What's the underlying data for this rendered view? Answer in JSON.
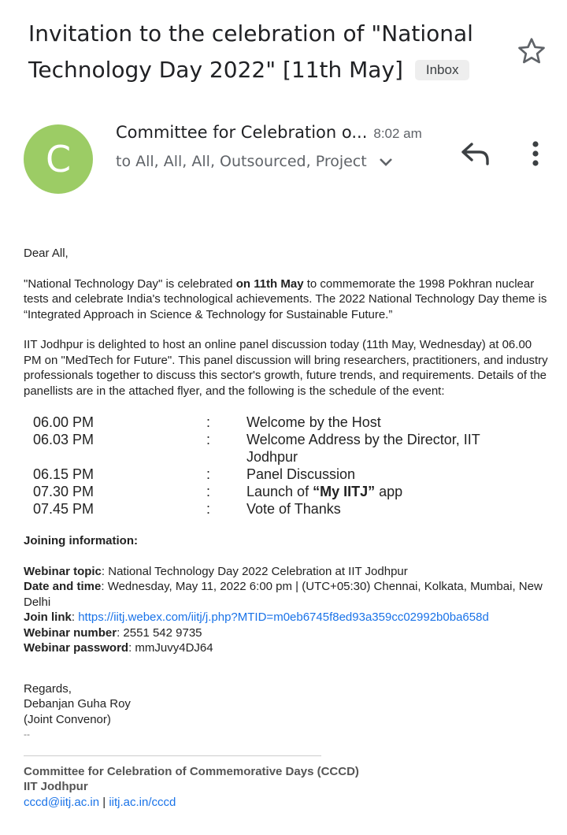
{
  "subject": {
    "title": "Invitation to the celebration of \"National Technology Day 2022\" [11th May]",
    "label": "Inbox"
  },
  "header": {
    "avatar_letter": "C",
    "avatar_color": "#9ccc65",
    "sender": "Committee for Celebration o...",
    "time": "8:02 am",
    "recipients": "to All, All, All, Outsourced, Project"
  },
  "icons": [
    "star-icon",
    "reply-icon",
    "more-vert-icon",
    "chevron-down-icon"
  ],
  "body": {
    "greeting": "Dear All,",
    "p1_a": "\"National Technology Day\" is celebrated ",
    "p1_bold": "on 11th May",
    "p1_b": " to commemorate the 1998 Pokhran nuclear tests and celebrate India's technological achievements. The 2022 National Technology Day theme is “Integrated Approach in Science & Technology for Sustainable Future.”",
    "p2": "IIT Jodhpur is delighted to host an online panel discussion today (11th May, Wednesday) at 06.00 PM on \"MedTech for Future\". This panel discussion will bring researchers, practitioners, and industry professionals together to discuss this sector's growth, future trends, and requirements. Details of the panellists are in the attached flyer, and the following is the schedule of the event:",
    "schedule": [
      {
        "time": "06.00 PM",
        "sep": ":",
        "desc": "Welcome by the Host"
      },
      {
        "time": "06.03 PM",
        "sep": ":",
        "desc": "Welcome Address by the Director, IIT Jodhpur"
      },
      {
        "time": "06.15 PM",
        "sep": ":",
        "desc": "Panel Discussion"
      },
      {
        "time": "07.30 PM",
        "sep": ":",
        "desc_a": "Launch of ",
        "desc_bold": "“My IITJ”",
        "desc_b": " app"
      },
      {
        "time": "07.45 PM",
        "sep": ":",
        "desc": "Vote of Thanks"
      }
    ],
    "joining_heading": "Joining information:",
    "topic_label": "Webinar topic",
    "topic_value": ": National Technology Day 2022 Celebration at IIT Jodhpur",
    "date_label": "Date and time",
    "date_value": ": Wednesday, May 11, 2022 6:00 pm | (UTC+05:30) Chennai, Kolkata, Mumbai, New Delhi",
    "join_label": "Join link",
    "join_sep": ": ",
    "join_url": "https://iitj.webex.com/iitj/j.php?MTID=m0eb6745f8ed93a359cc02992b0ba658d",
    "number_label": "Webinar number",
    "number_value": ": 2551 542 9735",
    "password_label": "Webinar password",
    "password_value": ": mmJuvy4DJ64",
    "regards": "Regards,",
    "signer_name": "Debanjan Guha Roy",
    "signer_role": "(Joint Convenor)",
    "dashes": "--",
    "sig_org": "Committee for Celebration of Commemorative Days (CCCD)",
    "sig_inst": "IIT Jodhpur",
    "sig_email": "cccd@iitj.ac.in",
    "sig_sep": " | ",
    "sig_web": "iitj.ac.in/cccd"
  }
}
